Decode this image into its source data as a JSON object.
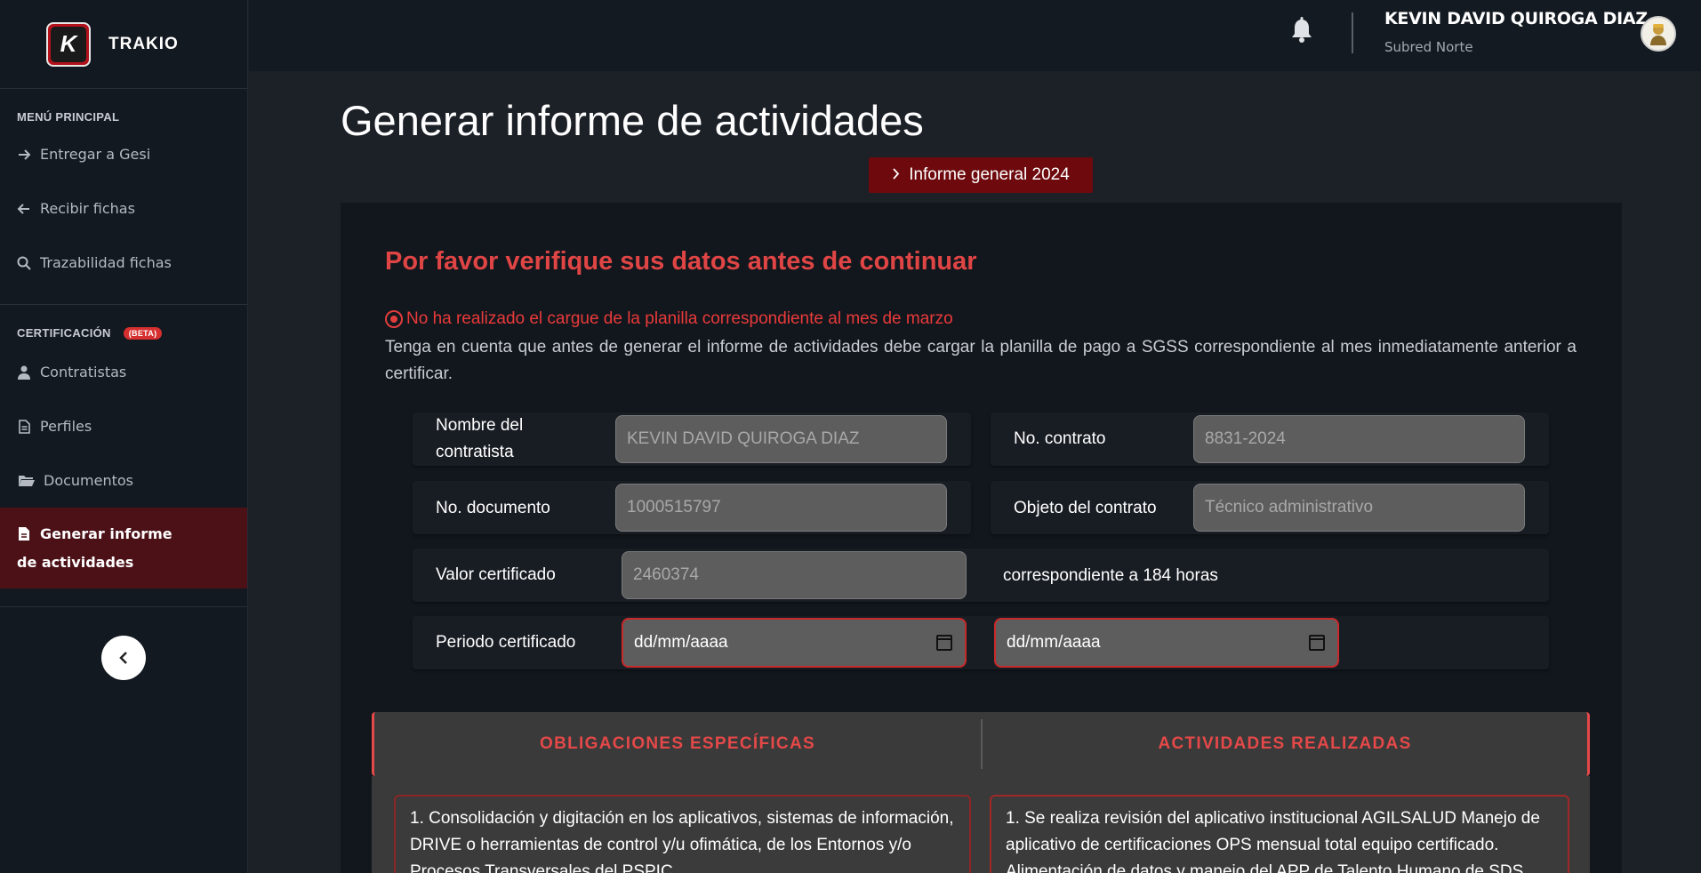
{
  "brand": {
    "name": "TRAKIO",
    "logo_letter": "K"
  },
  "sidebar": {
    "main_section": "MENÚ PRINCIPAL",
    "main_items": [
      {
        "label": "Entregar a Gesi",
        "icon": "arrow-right-icon"
      },
      {
        "label": "Recibir fichas",
        "icon": "arrow-left-icon"
      },
      {
        "label": "Trazabilidad fichas",
        "icon": "search-icon"
      }
    ],
    "cert_section": "CERTIFICACIÓN",
    "cert_badge": "(BETA)",
    "cert_items": [
      {
        "label": "Contratistas",
        "icon": "user-icon"
      },
      {
        "label": "Perfiles",
        "icon": "document-icon"
      },
      {
        "label": "Documentos",
        "icon": "folder-icon"
      },
      {
        "label": "Generar informe de actividades",
        "icon": "file-icon",
        "active": true
      }
    ]
  },
  "header": {
    "user_name": "KEVIN DAVID QUIROGA DIAZ",
    "user_subtitle": "Subred Norte"
  },
  "main": {
    "page_title": "Generar informe de actividades",
    "report_pill": "Informe general 2024",
    "verify_title": "Por favor verifique sus datos antes de continuar",
    "warning": "No ha realizado el cargue de la planilla correspondiente al mes de marzo",
    "info": "Tenga en cuenta que antes de generar el informe de actividades debe cargar la planilla de pago a SGSS correspondiente al mes inmediatamente anterior a certificar.",
    "form": {
      "contractor_name_label": "Nombre del contratista",
      "contractor_name_value": "KEVIN DAVID QUIROGA DIAZ",
      "contract_no_label": "No. contrato",
      "contract_no_value": "8831-2024",
      "document_no_label": "No. documento",
      "document_no_value": "1000515797",
      "contract_object_label": "Objeto del contrato",
      "contract_object_value": "Técnico administrativo",
      "certified_value_label": "Valor certificado",
      "certified_value_value": "2460374",
      "hours_text": "correspondiente a 184 horas",
      "period_label": "Periodo certificado",
      "period_start_placeholder": "dd/mm/aaaa",
      "period_end_placeholder": "dd/mm/aaaa"
    },
    "tabs": [
      "OBLIGACIONES ESPECÍFICAS",
      "ACTIVIDADES REALIZADAS"
    ],
    "obligation_text": "1. Consolidación y digitación en los aplicativos, sistemas de información, DRIVE o herramientas de control y/u ofimática, de los Entornos y/o Procesos Transversales del PSPIC",
    "activity_text": "1. Se realiza revisión del aplicativo institucional AGILSALUD Manejo de aplicativo de certificaciones OPS mensual total equipo certificado. Alimentación de datos y manejo del APP de Talento Humano de SDS"
  },
  "colors": {
    "accent": "#e54848",
    "active_bg": "#4b1117",
    "pill_bg": "#6e0a0d"
  }
}
